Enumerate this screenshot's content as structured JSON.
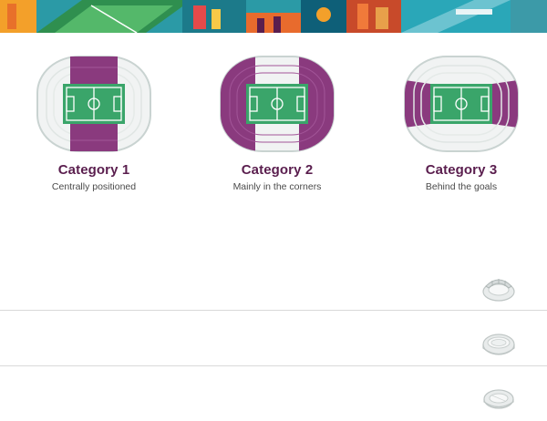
{
  "banner": {
    "icon": "city-illustration-banner"
  },
  "categories": [
    {
      "title": "Category 1",
      "subtitle": "Centrally positioned",
      "icon": "stadium-category-1-map"
    },
    {
      "title": "Category 2",
      "subtitle": "Mainly in the corners",
      "icon": "stadium-category-2-map"
    },
    {
      "title": "Category 3",
      "subtitle": "Behind the goals",
      "icon": "stadium-category-3-map"
    }
  ],
  "venue_rows": [
    {
      "icon": "stadium-covered-icon"
    },
    {
      "icon": "stadium-bowl-icon"
    },
    {
      "icon": "stadium-oval-icon"
    }
  ],
  "colors": {
    "accent": "#5a1e4e",
    "highlight": "#8a3a7e",
    "pitch": "#3aa56a",
    "divider": "#d9d9d9"
  }
}
